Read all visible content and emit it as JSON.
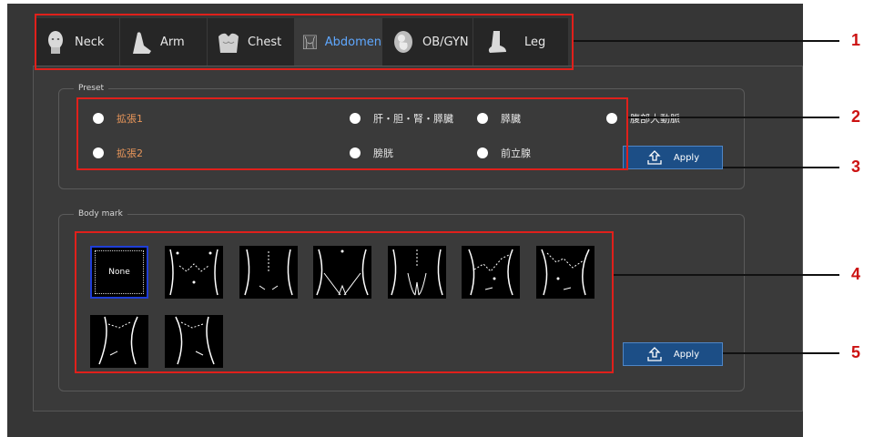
{
  "tabs": [
    {
      "label": "Neck",
      "icon": "head-icon"
    },
    {
      "label": "Arm",
      "icon": "arm-icon"
    },
    {
      "label": "Chest",
      "icon": "torso-icon"
    },
    {
      "label": "Abdomen",
      "icon": "abdomen-icon",
      "active": true
    },
    {
      "label": "OB/GYN",
      "icon": "fetus-icon"
    },
    {
      "label": "Leg",
      "icon": "foot-icon"
    }
  ],
  "preset": {
    "legend": "Preset",
    "options": [
      {
        "label": "拡張1",
        "selected": false
      },
      {
        "label": "肝・胆・腎・膵臓",
        "selected": false
      },
      {
        "label": "膵臓",
        "selected": false
      },
      {
        "label": "腹部大動脈",
        "selected": false
      },
      {
        "label": "拡張2",
        "selected": false
      },
      {
        "label": "膀胱",
        "selected": false
      },
      {
        "label": "前立腺",
        "selected": false
      }
    ],
    "apply_label": "Apply"
  },
  "bodymark": {
    "legend": "Body mark",
    "none_label": "None",
    "thumbnails": [
      "abdomen-front-bodymark-icon",
      "abdomen-lower-bodymark-icon",
      "abdomen-pelvis-bodymark-icon",
      "abdomen-groin-bodymark-icon",
      "abdomen-side-right-bodymark-icon",
      "abdomen-side-left-bodymark-icon",
      "abdomen-flank-right-bodymark-icon",
      "abdomen-flank-left-bodymark-icon"
    ],
    "apply_label": "Apply"
  },
  "callouts": [
    "1",
    "2",
    "3",
    "4",
    "5"
  ],
  "colors": {
    "active_tab": "#5fa8ff",
    "orange_text": "#e8965a",
    "apply_bg": "#1c4e86",
    "callout": "#e0201b",
    "number": "#cc1111"
  }
}
